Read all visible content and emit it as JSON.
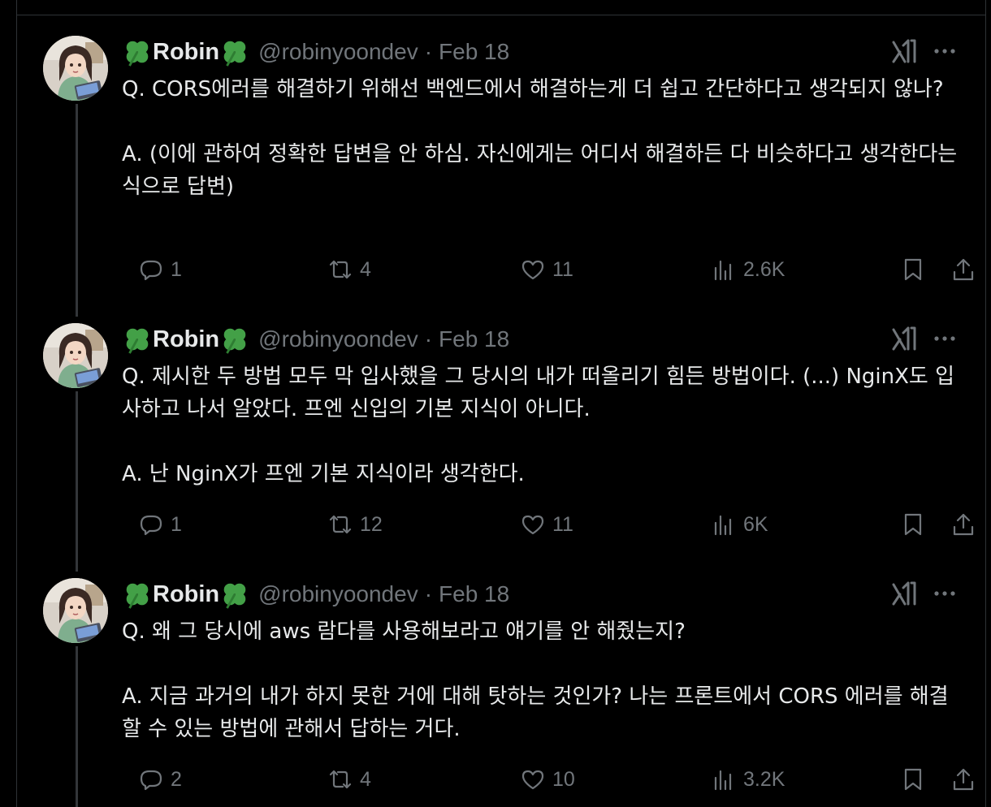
{
  "author": {
    "name": "Robin",
    "name_prefix_icon": "four-leaf-clover-icon",
    "name_suffix_icon": "four-leaf-clover-icon",
    "handle": "@robinyoondev",
    "separator": "·"
  },
  "icons": {
    "grok": "grok-icon",
    "more": "more-icon",
    "reply": "reply-icon",
    "retweet": "retweet-icon",
    "like": "heart-icon",
    "views": "views-icon",
    "bookmark": "bookmark-icon",
    "share": "share-icon"
  },
  "colors": {
    "background": "#000000",
    "text": "#e7e9ea",
    "muted": "#71767b",
    "divider": "#2f3336",
    "clover": "#43a047"
  },
  "tweets": [
    {
      "date": "Feb 18",
      "q": "Q. CORS에러를 해결하기 위해선 백엔드에서 해결하는게 더 쉽고 간단하다고 생각되지 않나?",
      "a": "A. (이에 관하여 정확한 답변을 안 하심. 자신에게는 어디서 해결하든 다 비슷하다고 생각한다는 식으로 답변)",
      "replies": "1",
      "reposts": "4",
      "likes": "11",
      "views": "2.6K"
    },
    {
      "date": "Feb 18",
      "q": "Q. 제시한 두 방법 모두 막 입사했을 그 당시의 내가 떠올리기 힘든 방법이다. (...) NginX도 입사하고 나서 알았다. 프엔 신입의 기본 지식이 아니다.",
      "a": "A. 난 NginX가 프엔 기본 지식이라 생각한다.",
      "replies": "1",
      "reposts": "12",
      "likes": "11",
      "views": "6K"
    },
    {
      "date": "Feb 18",
      "q": "Q. 왜 그 당시에 aws 람다를 사용해보라고 얘기를 안 해줬는지?",
      "a": "A. 지금 과거의 내가 하지 못한 거에 대해 탓하는 것인가? 나는 프론트에서 CORS 에러를 해결할 수 있는 방법에 관해서 답하는 거다.",
      "replies": "2",
      "reposts": "4",
      "likes": "10",
      "views": "3.2K"
    }
  ]
}
